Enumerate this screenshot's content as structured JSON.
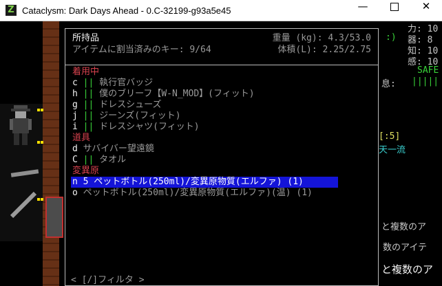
{
  "window": {
    "title": "Cataclysm: Dark Days Ahead - 0.C-32199-g93a5e45",
    "minimize_glyph": "—",
    "close_glyph": "✕",
    "app_icon_glyph": "Z"
  },
  "inventory": {
    "title": "所持品",
    "assigned_keys_label": "アイテムに割当済みのキー:",
    "assigned_keys_value": "9/64",
    "weight_label": "重量 (kg):",
    "weight_value": "4.3/53.0",
    "volume_label": "体積(L):",
    "volume_value": "2.25/2.75",
    "categories": [
      {
        "label": "着用中",
        "items": [
          {
            "key": "c",
            "bar": "||",
            "name": "執行官バッジ"
          },
          {
            "key": "h",
            "bar": "||",
            "name": "僕のブリーフ【W-N_MOD】(フィット)"
          },
          {
            "key": "g",
            "bar": "||",
            "name": "ドレスシューズ"
          },
          {
            "key": "j",
            "bar": "||",
            "name": "ジーンズ(フィット)"
          },
          {
            "key": "i",
            "bar": "||",
            "name": "ドレスシャツ(フィット)"
          }
        ]
      },
      {
        "label": "道具",
        "items": [
          {
            "key": "d",
            "bar": "",
            "name": "サバイバー望遠鏡"
          },
          {
            "key": "C",
            "bar": "||",
            "name": "タオル"
          }
        ]
      },
      {
        "label": "変異原",
        "items": [
          {
            "key": "n",
            "bar": "",
            "name": "5 ペットボトル(250ml)/変異原物質(エルファ) (1)"
          },
          {
            "key": "o",
            "bar": "",
            "name": "ペットボトル(250ml)/変異原物質(エルファ)(温) (1)"
          }
        ]
      }
    ],
    "footer": "< [/]フィルタ >"
  },
  "sidebar": {
    "stat_str": "力: 10",
    "stat_dex": "器: 8",
    "stat_int": "知: 10",
    "stat_per": "感: 10",
    "safe": "SAFE",
    "focus_label": "息:",
    "focus_bars": "|||||",
    "paren": ":)",
    "bracket": "[:5]",
    "style": "天一流",
    "msg1": "と複数のア",
    "msg2": "数のアイテ",
    "msg3": "と複数のア"
  },
  "colors": {
    "category": "#d6424e",
    "highlight": "#1414d8",
    "condition_bar": "#39d339"
  }
}
